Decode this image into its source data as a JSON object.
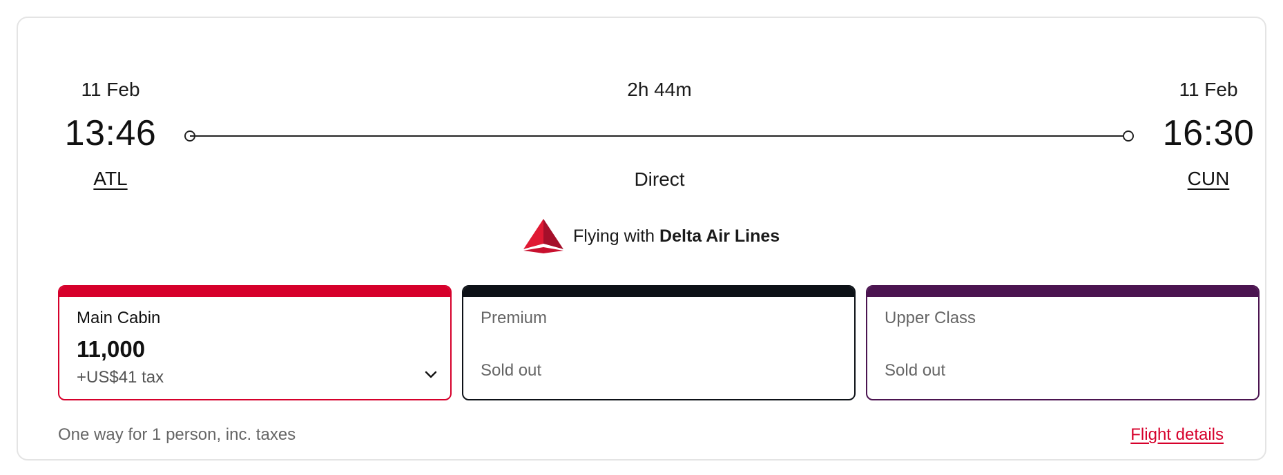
{
  "flight": {
    "departure": {
      "date": "11 Feb",
      "time": "13:46",
      "airport": "ATL"
    },
    "arrival": {
      "date": "11 Feb",
      "time": "16:30",
      "airport": "CUN"
    },
    "duration": "2h 44m",
    "stops": "Direct"
  },
  "airline": {
    "prefix": "Flying with",
    "name": "Delta Air Lines",
    "logo_icon": "delta-widget-icon"
  },
  "fares": [
    {
      "name": "Main Cabin",
      "points": "11,000",
      "tax": "+US$41 tax",
      "status": "",
      "color": "#d6002b"
    },
    {
      "name": "Premium",
      "points": "",
      "tax": "",
      "status": "Sold out",
      "color": "#0d1117"
    },
    {
      "name": "Upper Class",
      "points": "",
      "tax": "",
      "status": "Sold out",
      "color": "#4b1450"
    }
  ],
  "footer": {
    "note": "One way for 1 person, inc. taxes",
    "details_link": "Flight details"
  }
}
